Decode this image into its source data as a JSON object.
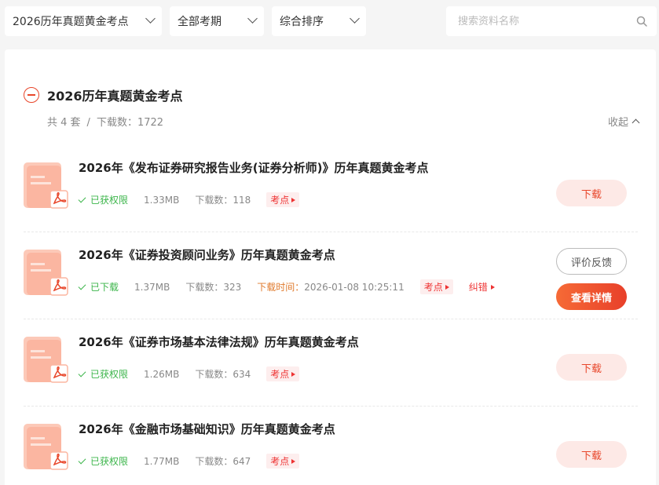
{
  "filters": {
    "exam": "2026历年真题黄金考点",
    "period": "全部考期",
    "sort": "综合排序",
    "search_placeholder": "搜索资料名称"
  },
  "section": {
    "title": "2026历年真题黄金考点",
    "count_text": "共 4 套",
    "separator": "/",
    "downloads_text": "下载数：1722",
    "collapse_label": "收起"
  },
  "items": [
    {
      "title": "2026年《发布证券研究报告业务(证券分析师)》历年真题黄金考点",
      "status": "已获权限",
      "size": "1.33MB",
      "downloads": "下载数：118",
      "tag": "考点",
      "button": "下载"
    },
    {
      "title": "2026年《证券投资顾问业务》历年真题黄金考点",
      "status": "已下载",
      "size": "1.37MB",
      "downloads": "下载数：323",
      "download_time_label": "下载时间：",
      "download_time": "2026-01-08 10:25:11",
      "tag": "考点",
      "report": "纠错",
      "feedback_button": "评价反馈",
      "detail_button": "查看详情"
    },
    {
      "title": "2026年《证券市场基本法律法规》历年真题黄金考点",
      "status": "已获权限",
      "size": "1.26MB",
      "downloads": "下载数：634",
      "tag": "考点",
      "button": "下载"
    },
    {
      "title": "2026年《金融市场基础知识》历年真题黄金考点",
      "status": "已获权限",
      "size": "1.77MB",
      "downloads": "下载数：647",
      "tag": "考点",
      "button": "下载"
    }
  ],
  "colors": {
    "accent": "#e8462a",
    "success": "#3bb54a",
    "time": "#e07a2c"
  }
}
